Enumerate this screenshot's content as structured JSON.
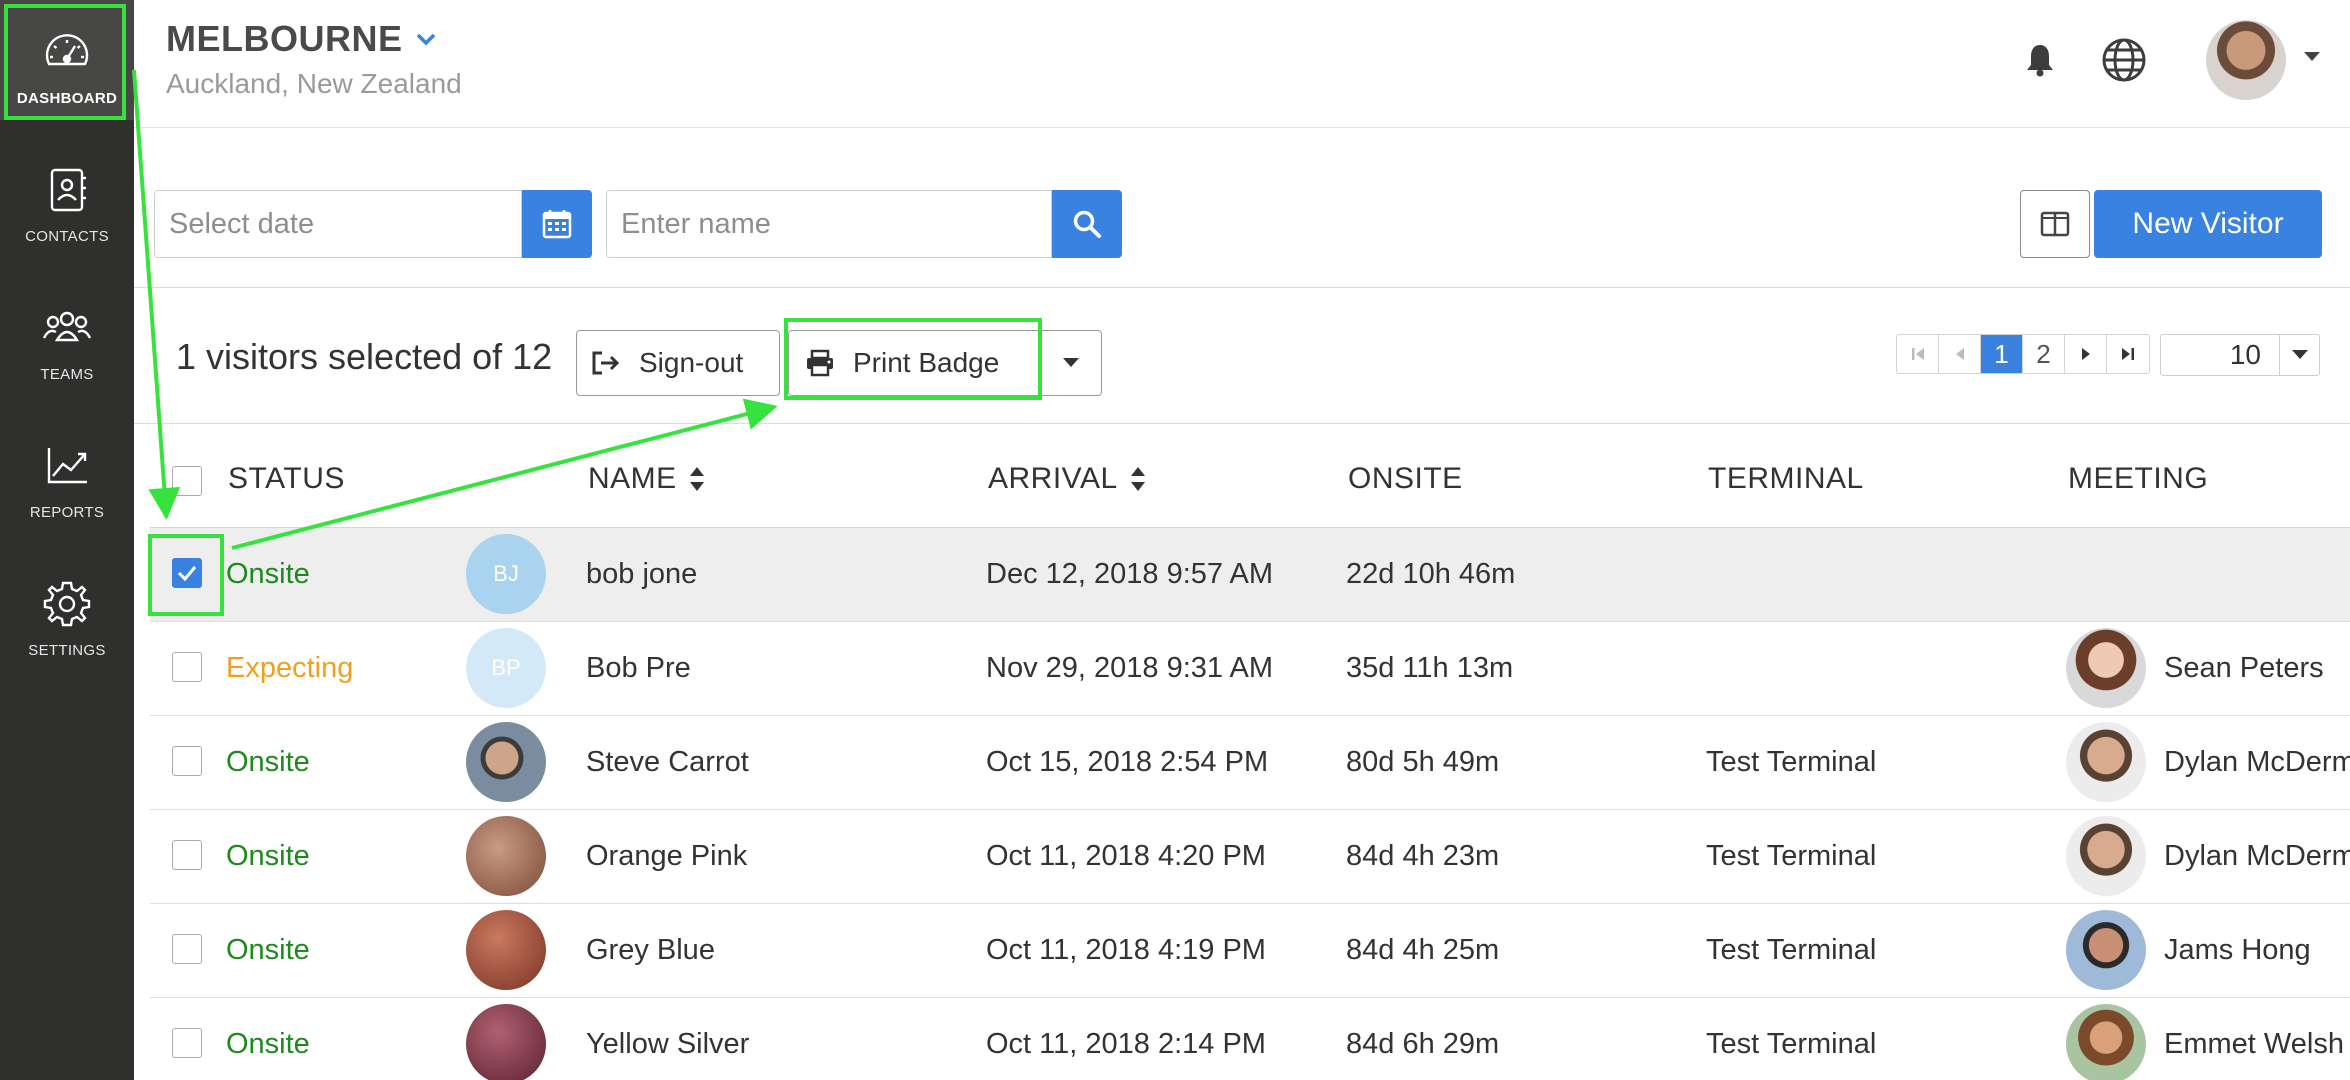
{
  "sidebar": {
    "items": [
      {
        "label": "DASHBOARD",
        "icon": "speedometer-icon"
      },
      {
        "label": "CONTACTS",
        "icon": "contacts-book-icon"
      },
      {
        "label": "TEAMS",
        "icon": "team-group-icon"
      },
      {
        "label": "REPORTS",
        "icon": "chart-trend-icon"
      },
      {
        "label": "SETTINGS",
        "icon": "gear-icon"
      }
    ]
  },
  "header": {
    "title": "MELBOURNE",
    "subtitle": "Auckland, New Zealand"
  },
  "filters": {
    "date_placeholder": "Select date",
    "name_placeholder": "Enter name",
    "new_visitor_label": "New Visitor"
  },
  "actions": {
    "selection_text": "1 visitors selected of 12",
    "signout_label": "Sign-out",
    "print_badge_label": "Print Badge"
  },
  "pagination": {
    "pages": [
      "1",
      "2"
    ],
    "current": "1",
    "per_page": "10"
  },
  "table": {
    "headers": {
      "status": "STATUS",
      "name": "NAME",
      "arrival": "ARRIVAL",
      "onsite": "ONSITE",
      "terminal": "TERMINAL",
      "meeting": "MEETING"
    },
    "rows": [
      {
        "status": "Onsite",
        "initials": "BJ",
        "name": "bob jone",
        "arrival": "Dec 12, 2018 9:57 AM",
        "onsite": "22d 10h 46m",
        "terminal": "",
        "meeting": ""
      },
      {
        "status": "Expecting",
        "initials": "BP",
        "name": "Bob Pre",
        "arrival": "Nov 29, 2018 9:31 AM",
        "onsite": "35d 11h 13m",
        "terminal": "",
        "meeting": "Sean Peters"
      },
      {
        "status": "Onsite",
        "initials": "",
        "name": "Steve Carrot",
        "arrival": "Oct 15, 2018 2:54 PM",
        "onsite": "80d 5h 49m",
        "terminal": "Test Terminal",
        "meeting": "Dylan McDerm"
      },
      {
        "status": "Onsite",
        "initials": "",
        "name": "Orange Pink",
        "arrival": "Oct 11, 2018 4:20 PM",
        "onsite": "84d 4h 23m",
        "terminal": "Test Terminal",
        "meeting": "Dylan McDerm"
      },
      {
        "status": "Onsite",
        "initials": "",
        "name": "Grey Blue",
        "arrival": "Oct 11, 2018 4:19 PM",
        "onsite": "84d 4h 25m",
        "terminal": "Test Terminal",
        "meeting": "Jams Hong"
      },
      {
        "status": "Onsite",
        "initials": "",
        "name": "Yellow Silver",
        "arrival": "Oct 11, 2018 2:14 PM",
        "onsite": "84d 6h 29m",
        "terminal": "Test Terminal",
        "meeting": "Emmet Welsh"
      }
    ]
  },
  "colors": {
    "accent": "#3a82df",
    "sidebar": "#2f302d",
    "onsite": "#1e8a1e",
    "expecting": "#f0a020",
    "highlight": "#36e23d"
  }
}
